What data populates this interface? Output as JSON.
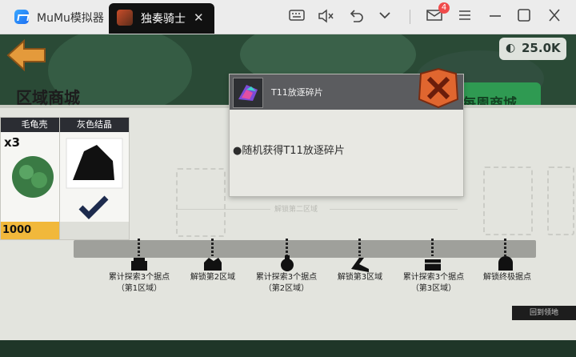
{
  "titlebar": {
    "app_title": "MuMu模拟器",
    "tab_label": "独奏骑士",
    "tab_close": "✕",
    "icons": [
      "keyboard-icon",
      "mute-icon",
      "undo-icon",
      "chevron-down-icon",
      "mail-icon",
      "menu-icon",
      "minimize-icon",
      "maximize-icon",
      "close-icon"
    ],
    "mail_badge": "4"
  },
  "game": {
    "currency": {
      "icon": "◐",
      "value": "25.0K"
    },
    "weekly_shop_tab": "每周商城",
    "region_shop_title": "区域商城",
    "items": [
      {
        "name": "毛龟壳",
        "count": "x3",
        "price": "1000"
      },
      {
        "name": "灰色结晶",
        "count": "",
        "price": ""
      }
    ],
    "divider_label": "解锁第二区域",
    "popup": {
      "title": "T11放逐碎片",
      "description": "●随机获得T11放逐碎片"
    },
    "milestones": [
      {
        "label": "累计探索3个据点（第1区域）"
      },
      {
        "label": "解锁第2区域"
      },
      {
        "label": "累计探索3个据点（第2区域）"
      },
      {
        "label": "解锁第3区域"
      },
      {
        "label": "累计探索3个据点（第3区域）"
      },
      {
        "label": "解锁终极据点"
      }
    ],
    "bottom_button": "回到领地"
  },
  "colors": {
    "accent_green": "#2f9a52",
    "close_orange": "#e0662f",
    "price_yellow": "#f1b83b",
    "back_arrow": "#e49a3b"
  }
}
